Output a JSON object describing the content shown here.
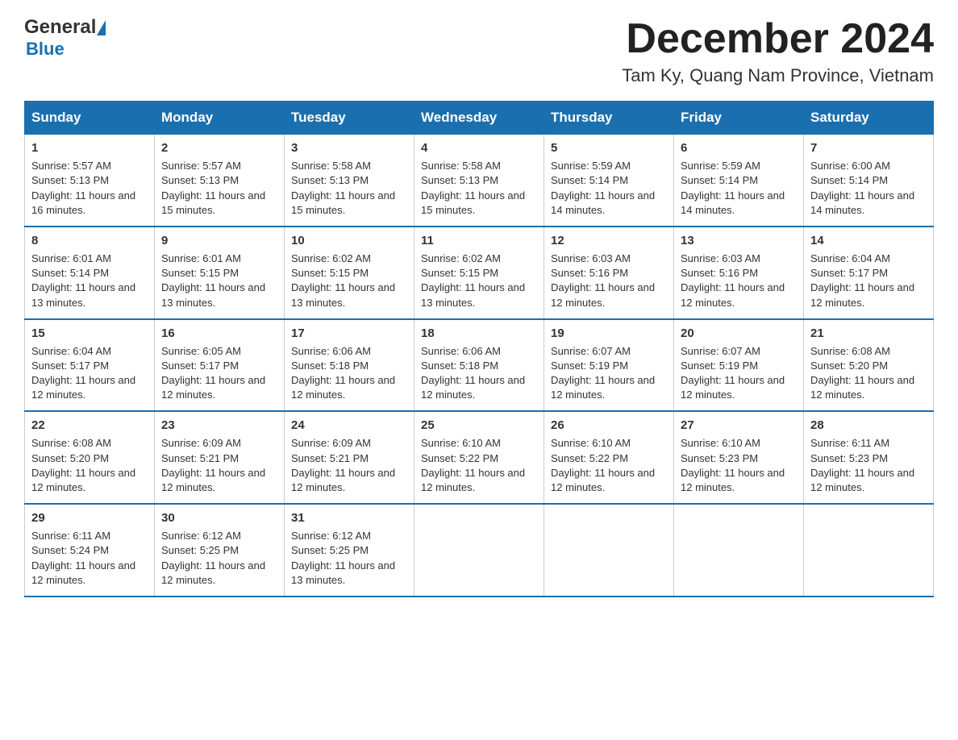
{
  "header": {
    "logo": {
      "general": "General",
      "blue": "Blue"
    },
    "title": "December 2024",
    "subtitle": "Tam Ky, Quang Nam Province, Vietnam"
  },
  "calendar": {
    "columns": [
      "Sunday",
      "Monday",
      "Tuesday",
      "Wednesday",
      "Thursday",
      "Friday",
      "Saturday"
    ],
    "weeks": [
      [
        {
          "day": "1",
          "sunrise": "Sunrise: 5:57 AM",
          "sunset": "Sunset: 5:13 PM",
          "daylight": "Daylight: 11 hours and 16 minutes."
        },
        {
          "day": "2",
          "sunrise": "Sunrise: 5:57 AM",
          "sunset": "Sunset: 5:13 PM",
          "daylight": "Daylight: 11 hours and 15 minutes."
        },
        {
          "day": "3",
          "sunrise": "Sunrise: 5:58 AM",
          "sunset": "Sunset: 5:13 PM",
          "daylight": "Daylight: 11 hours and 15 minutes."
        },
        {
          "day": "4",
          "sunrise": "Sunrise: 5:58 AM",
          "sunset": "Sunset: 5:13 PM",
          "daylight": "Daylight: 11 hours and 15 minutes."
        },
        {
          "day": "5",
          "sunrise": "Sunrise: 5:59 AM",
          "sunset": "Sunset: 5:14 PM",
          "daylight": "Daylight: 11 hours and 14 minutes."
        },
        {
          "day": "6",
          "sunrise": "Sunrise: 5:59 AM",
          "sunset": "Sunset: 5:14 PM",
          "daylight": "Daylight: 11 hours and 14 minutes."
        },
        {
          "day": "7",
          "sunrise": "Sunrise: 6:00 AM",
          "sunset": "Sunset: 5:14 PM",
          "daylight": "Daylight: 11 hours and 14 minutes."
        }
      ],
      [
        {
          "day": "8",
          "sunrise": "Sunrise: 6:01 AM",
          "sunset": "Sunset: 5:14 PM",
          "daylight": "Daylight: 11 hours and 13 minutes."
        },
        {
          "day": "9",
          "sunrise": "Sunrise: 6:01 AM",
          "sunset": "Sunset: 5:15 PM",
          "daylight": "Daylight: 11 hours and 13 minutes."
        },
        {
          "day": "10",
          "sunrise": "Sunrise: 6:02 AM",
          "sunset": "Sunset: 5:15 PM",
          "daylight": "Daylight: 11 hours and 13 minutes."
        },
        {
          "day": "11",
          "sunrise": "Sunrise: 6:02 AM",
          "sunset": "Sunset: 5:15 PM",
          "daylight": "Daylight: 11 hours and 13 minutes."
        },
        {
          "day": "12",
          "sunrise": "Sunrise: 6:03 AM",
          "sunset": "Sunset: 5:16 PM",
          "daylight": "Daylight: 11 hours and 12 minutes."
        },
        {
          "day": "13",
          "sunrise": "Sunrise: 6:03 AM",
          "sunset": "Sunset: 5:16 PM",
          "daylight": "Daylight: 11 hours and 12 minutes."
        },
        {
          "day": "14",
          "sunrise": "Sunrise: 6:04 AM",
          "sunset": "Sunset: 5:17 PM",
          "daylight": "Daylight: 11 hours and 12 minutes."
        }
      ],
      [
        {
          "day": "15",
          "sunrise": "Sunrise: 6:04 AM",
          "sunset": "Sunset: 5:17 PM",
          "daylight": "Daylight: 11 hours and 12 minutes."
        },
        {
          "day": "16",
          "sunrise": "Sunrise: 6:05 AM",
          "sunset": "Sunset: 5:17 PM",
          "daylight": "Daylight: 11 hours and 12 minutes."
        },
        {
          "day": "17",
          "sunrise": "Sunrise: 6:06 AM",
          "sunset": "Sunset: 5:18 PM",
          "daylight": "Daylight: 11 hours and 12 minutes."
        },
        {
          "day": "18",
          "sunrise": "Sunrise: 6:06 AM",
          "sunset": "Sunset: 5:18 PM",
          "daylight": "Daylight: 11 hours and 12 minutes."
        },
        {
          "day": "19",
          "sunrise": "Sunrise: 6:07 AM",
          "sunset": "Sunset: 5:19 PM",
          "daylight": "Daylight: 11 hours and 12 minutes."
        },
        {
          "day": "20",
          "sunrise": "Sunrise: 6:07 AM",
          "sunset": "Sunset: 5:19 PM",
          "daylight": "Daylight: 11 hours and 12 minutes."
        },
        {
          "day": "21",
          "sunrise": "Sunrise: 6:08 AM",
          "sunset": "Sunset: 5:20 PM",
          "daylight": "Daylight: 11 hours and 12 minutes."
        }
      ],
      [
        {
          "day": "22",
          "sunrise": "Sunrise: 6:08 AM",
          "sunset": "Sunset: 5:20 PM",
          "daylight": "Daylight: 11 hours and 12 minutes."
        },
        {
          "day": "23",
          "sunrise": "Sunrise: 6:09 AM",
          "sunset": "Sunset: 5:21 PM",
          "daylight": "Daylight: 11 hours and 12 minutes."
        },
        {
          "day": "24",
          "sunrise": "Sunrise: 6:09 AM",
          "sunset": "Sunset: 5:21 PM",
          "daylight": "Daylight: 11 hours and 12 minutes."
        },
        {
          "day": "25",
          "sunrise": "Sunrise: 6:10 AM",
          "sunset": "Sunset: 5:22 PM",
          "daylight": "Daylight: 11 hours and 12 minutes."
        },
        {
          "day": "26",
          "sunrise": "Sunrise: 6:10 AM",
          "sunset": "Sunset: 5:22 PM",
          "daylight": "Daylight: 11 hours and 12 minutes."
        },
        {
          "day": "27",
          "sunrise": "Sunrise: 6:10 AM",
          "sunset": "Sunset: 5:23 PM",
          "daylight": "Daylight: 11 hours and 12 minutes."
        },
        {
          "day": "28",
          "sunrise": "Sunrise: 6:11 AM",
          "sunset": "Sunset: 5:23 PM",
          "daylight": "Daylight: 11 hours and 12 minutes."
        }
      ],
      [
        {
          "day": "29",
          "sunrise": "Sunrise: 6:11 AM",
          "sunset": "Sunset: 5:24 PM",
          "daylight": "Daylight: 11 hours and 12 minutes."
        },
        {
          "day": "30",
          "sunrise": "Sunrise: 6:12 AM",
          "sunset": "Sunset: 5:25 PM",
          "daylight": "Daylight: 11 hours and 12 minutes."
        },
        {
          "day": "31",
          "sunrise": "Sunrise: 6:12 AM",
          "sunset": "Sunset: 5:25 PM",
          "daylight": "Daylight: 11 hours and 13 minutes."
        },
        null,
        null,
        null,
        null
      ]
    ]
  }
}
